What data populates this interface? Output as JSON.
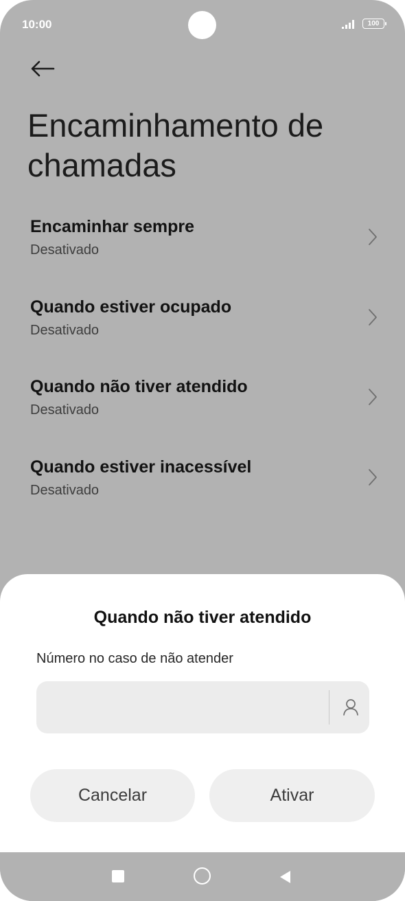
{
  "status_bar": {
    "time": "10:00",
    "battery": "100"
  },
  "header": {
    "title": "Encaminhamento de chamadas"
  },
  "settings": {
    "items": [
      {
        "title": "Encaminhar sempre",
        "subtitle": "Desativado"
      },
      {
        "title": "Quando estiver ocupado",
        "subtitle": "Desativado"
      },
      {
        "title": "Quando não tiver atendido",
        "subtitle": "Desativado"
      },
      {
        "title": "Quando estiver inacessível",
        "subtitle": "Desativado"
      }
    ]
  },
  "dialog": {
    "title": "Quando não tiver atendido",
    "field_label": "Número no caso de não atender",
    "field_value": "",
    "cancel_label": "Cancelar",
    "activate_label": "Ativar"
  },
  "icons": {
    "back": "arrow-left-icon",
    "chevron": "chevron-right-icon",
    "contact": "contact-person-icon",
    "nav_recent": "square-icon",
    "nav_home": "circle-icon",
    "nav_back": "triangle-left-icon"
  },
  "colors": {
    "scrim_background": "#b2b2b2",
    "sheet_background": "#ffffff",
    "button_background": "#efefef",
    "input_background": "#ececec"
  }
}
